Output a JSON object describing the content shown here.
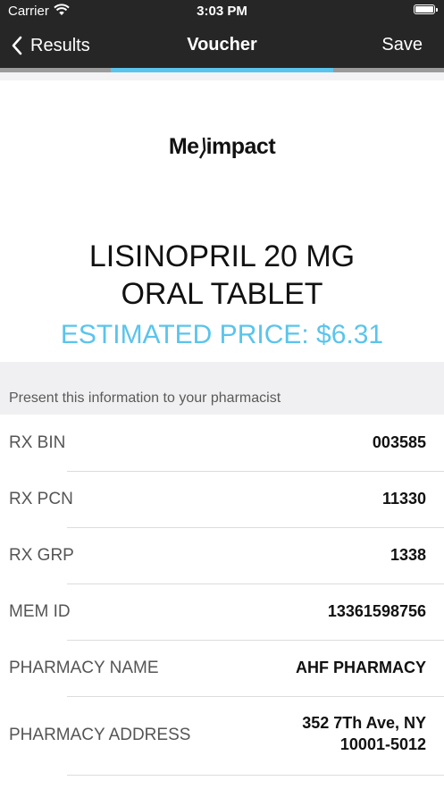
{
  "status_bar": {
    "carrier": "Carrier",
    "time": "3:03 PM"
  },
  "nav": {
    "back_label": "Results",
    "title": "Voucher",
    "save_label": "Save"
  },
  "progress": {
    "start_fraction": 0.25,
    "end_fraction": 0.75,
    "color": "#5ac4ec"
  },
  "logo_text": {
    "part1": "Me",
    "part2": "impact"
  },
  "drug": {
    "name_line1": "LISINOPRIL 20 MG",
    "name_line2": "ORAL TABLET",
    "price": "ESTIMATED PRICE: $6.31"
  },
  "section": {
    "header": "Present this information to your pharmacist"
  },
  "rows": [
    {
      "label": "RX BIN",
      "value": "003585"
    },
    {
      "label": "RX PCN",
      "value": "11330"
    },
    {
      "label": "RX GRP",
      "value": "1338"
    },
    {
      "label": "MEM ID",
      "value": "13361598756"
    },
    {
      "label": "PHARMACY NAME",
      "value": "AHF PHARMACY"
    },
    {
      "label": "PHARMACY ADDRESS",
      "value_line1": "352 7Th Ave, NY",
      "value_line2": "10001-5012"
    }
  ],
  "colors": {
    "bar_background": "#262626",
    "accent": "#5ac4ec",
    "section_background": "#f0f0f2"
  }
}
